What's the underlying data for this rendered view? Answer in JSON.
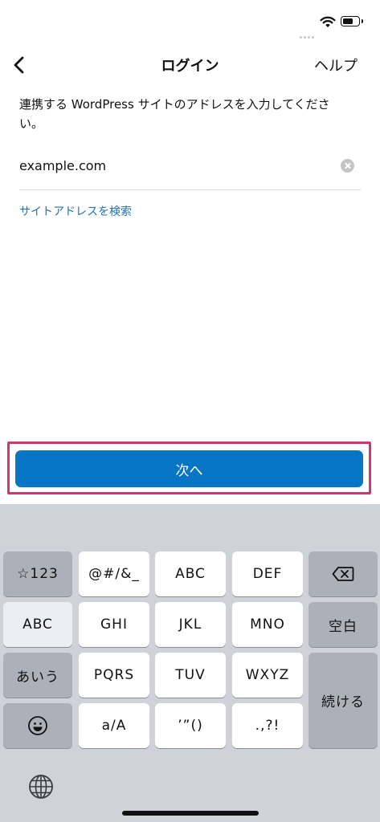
{
  "nav": {
    "title": "ログイン",
    "help_label": "ヘルプ"
  },
  "instructions": "連携する WordPress サイトのアドレスを入力してください。",
  "site_field": {
    "value": "example.com"
  },
  "find_address_link": "サイトアドレスを検索",
  "next_button": "次へ",
  "keyboard": {
    "row1": [
      "☆123",
      "@#/&_",
      "ABC",
      "DEF"
    ],
    "row2": [
      "ABC",
      "GHI",
      "JKL",
      "MNO",
      "空白"
    ],
    "row3": [
      "あいう",
      "PQRS",
      "TUV",
      "WXYZ"
    ],
    "row4": [
      "a/A",
      "’”()",
      ".,?!"
    ],
    "return_label": "続ける"
  },
  "colors": {
    "accent": "#0675c4",
    "highlight_border": "#d2366a",
    "link": "#2271b1"
  }
}
